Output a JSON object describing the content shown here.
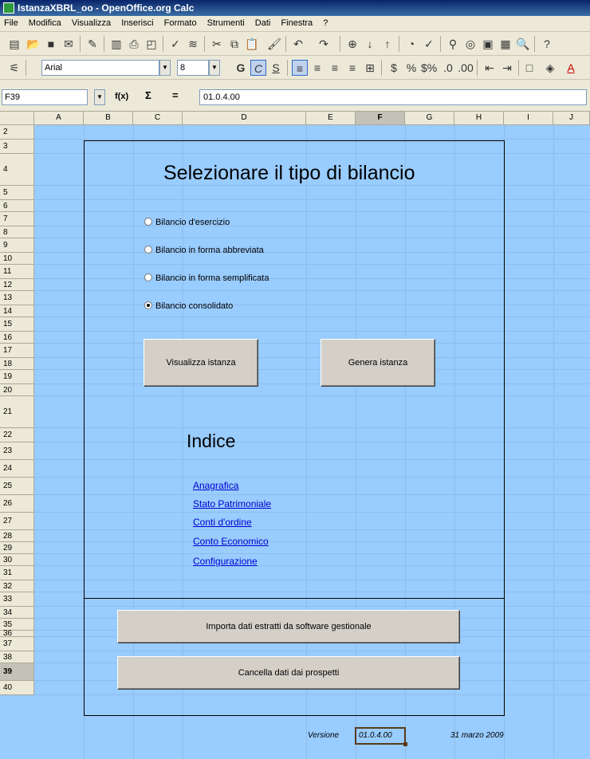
{
  "window": {
    "title": "IstanzaXBRL_oo - OpenOffice.org Calc"
  },
  "menu": [
    "File",
    "Modifica",
    "Visualizza",
    "Inserisci",
    "Formato",
    "Strumenti",
    "Dati",
    "Finestra",
    "?"
  ],
  "format_bar": {
    "font_name": "Arial",
    "font_size": "8",
    "bold": "G",
    "italic": "C",
    "underline": "S"
  },
  "formula_bar": {
    "cell_ref": "F39",
    "fx": "f(x)",
    "sum": "Σ",
    "equals": "=",
    "value": "01.0.4.00"
  },
  "columns": [
    "A",
    "B",
    "C",
    "D",
    "E",
    "F",
    "G",
    "H",
    "I",
    "J"
  ],
  "selected_column": "F",
  "rows": [
    "2",
    "3",
    "4",
    "5",
    "6",
    "7",
    "8",
    "9",
    "10",
    "11",
    "12",
    "13",
    "14",
    "15",
    "16",
    "17",
    "18",
    "19",
    "20",
    "21",
    "22",
    "23",
    "24",
    "25",
    "26",
    "27",
    "28",
    "29",
    "30",
    "31",
    "32",
    "33",
    "34",
    "35",
    "36",
    "37",
    "38",
    "39",
    "40"
  ],
  "selected_row": "39",
  "sheet": {
    "title": "Selezionare il tipo di bilancio",
    "options": [
      {
        "label": "Bilancio d'esercizio",
        "selected": false
      },
      {
        "label": "Bilancio in forma abbreviata",
        "selected": false
      },
      {
        "label": "Bilancio in forma semplificata",
        "selected": false
      },
      {
        "label": "Bilancio consolidato",
        "selected": true
      }
    ],
    "btn_visualizza": "Visualizza istanza",
    "btn_genera": "Genera istanza",
    "indice_title": "Indice",
    "links": [
      "Anagrafica",
      "Stato Patrimoniale",
      "Conti d'ordine",
      "Conto Economico",
      "Configurazione"
    ],
    "btn_importa": "Importa dati estratti da software gestionale",
    "btn_cancella": "Cancella dati dai prospetti",
    "version_label": "Versione",
    "version_value": "01.0.4.00",
    "date": "31 marzo 2009"
  }
}
